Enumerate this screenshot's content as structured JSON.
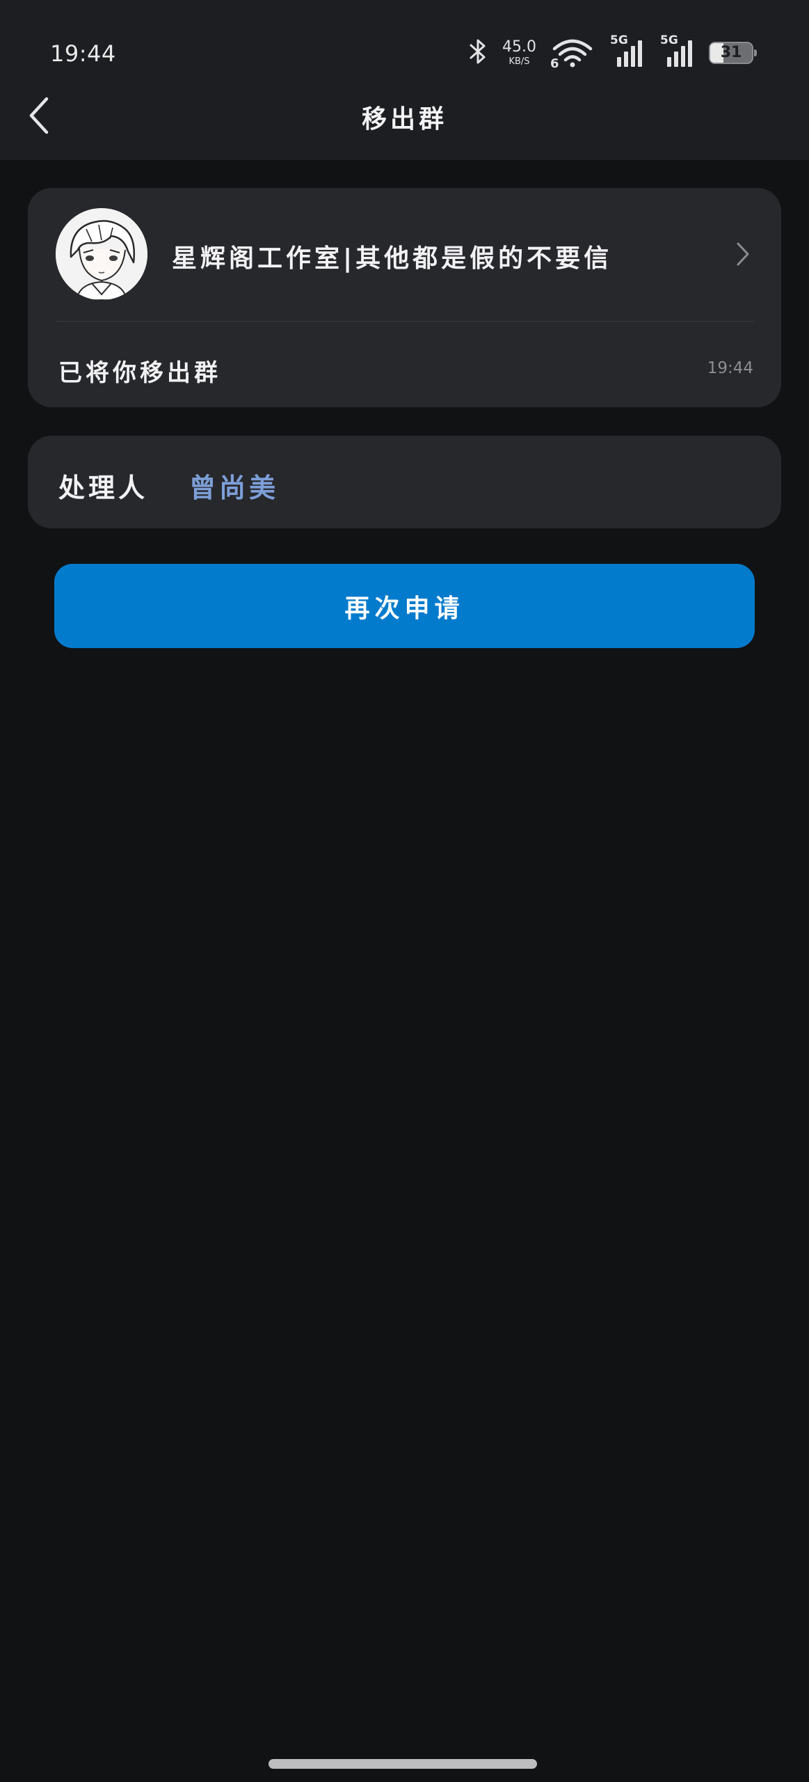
{
  "status_bar": {
    "time": "19:44",
    "net_speed": "45.0",
    "net_speed_unit": "KB/S",
    "wifi_band": "6",
    "sim1_label": "5G",
    "sim2_label": "5G",
    "battery_level": "31",
    "icons": [
      "bluetooth-icon",
      "wifi-icon",
      "signal-icon",
      "signal-icon",
      "battery-icon"
    ]
  },
  "nav": {
    "title": "移出群",
    "back_icon": "chevron-left-icon"
  },
  "group": {
    "name": "星辉阁工作室|其他都是假的不要信",
    "avatar_icon": "anime-avatar-icon",
    "message": "已将你移出群",
    "time": "19:44"
  },
  "handler": {
    "label": "处理人",
    "name": "曾尚美"
  },
  "actions": {
    "reapply_label": "再次申请"
  },
  "colors": {
    "background": "#111214",
    "card": "#27282c",
    "accent_button": "#037bcd",
    "link_text": "#7d9fd8"
  }
}
